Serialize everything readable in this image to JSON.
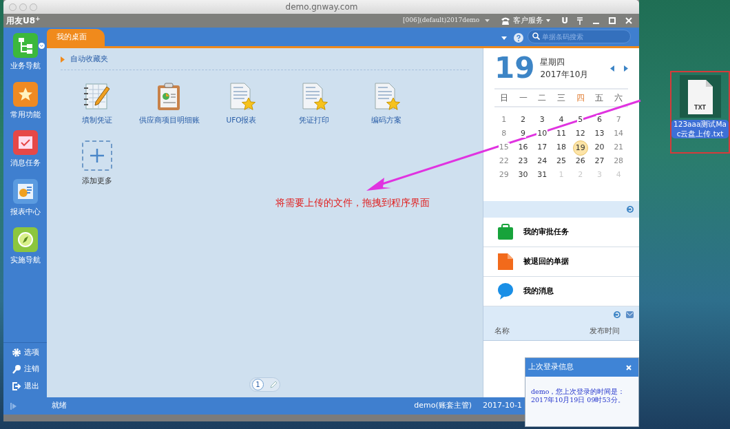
{
  "window": {
    "title": "demo.gnway.com"
  },
  "app_bar": {
    "logo": "用友U8$^{+}$",
    "account": "[006](default)2017demo",
    "service": "客户服务",
    "u_label": "U"
  },
  "sidebar": {
    "items": [
      {
        "label": "业务导航",
        "kind": "tree",
        "has_menu": true
      },
      {
        "label": "常用功能",
        "kind": "star",
        "has_menu": false
      },
      {
        "label": "消息任务",
        "kind": "check",
        "has_menu": false
      },
      {
        "label": "报表中心",
        "kind": "chart",
        "has_menu": false
      },
      {
        "label": "实施导航",
        "kind": "compass",
        "has_menu": false
      }
    ],
    "bottom_items": [
      {
        "label": "选项",
        "kind": "gear"
      },
      {
        "label": "注销",
        "kind": "key"
      },
      {
        "label": "退出",
        "kind": "exit"
      }
    ]
  },
  "tabs": [
    {
      "label": "我的桌面",
      "selected": true
    }
  ],
  "search": {
    "placeholder": "单据条码搜索"
  },
  "favorites": {
    "title": "自动收藏夹",
    "items": [
      {
        "label": "填制凭证",
        "kind": "ledger"
      },
      {
        "label": "供应商项目明细账",
        "kind": "clipboard"
      },
      {
        "label": "UFO报表",
        "kind": "report"
      },
      {
        "label": "凭证打印",
        "kind": "report"
      },
      {
        "label": "编码方案",
        "kind": "report"
      }
    ],
    "add_label": "添加更多"
  },
  "annotation": {
    "text": "将需要上传的文件，拖拽到程序界面"
  },
  "pager": {
    "pages": [
      {
        "label": "1",
        "selected": true
      }
    ]
  },
  "calendar": {
    "day": "19",
    "weekday": "星期四",
    "month": "2017年10月",
    "weekdays": [
      {
        "label": "日",
        "highlighted": false
      },
      {
        "label": "一",
        "highlighted": false
      },
      {
        "label": "二",
        "highlighted": false
      },
      {
        "label": "三",
        "highlighted": false
      },
      {
        "label": "四",
        "highlighted": true
      },
      {
        "label": "五",
        "highlighted": false
      },
      {
        "label": "六",
        "highlighted": false
      }
    ],
    "days": [
      {
        "label": "1",
        "kind": "current",
        "selected": false
      },
      {
        "label": "2",
        "kind": "current",
        "selected": false
      },
      {
        "label": "3",
        "kind": "current",
        "selected": false
      },
      {
        "label": "4",
        "kind": "current",
        "selected": false
      },
      {
        "label": "5",
        "kind": "current",
        "selected": false
      },
      {
        "label": "6",
        "kind": "current",
        "selected": false
      },
      {
        "label": "7",
        "kind": "current",
        "selected": false
      },
      {
        "label": "8",
        "kind": "current",
        "selected": false
      },
      {
        "label": "9",
        "kind": "current",
        "selected": false
      },
      {
        "label": "10",
        "kind": "current",
        "selected": false
      },
      {
        "label": "11",
        "kind": "current",
        "selected": false
      },
      {
        "label": "12",
        "kind": "current",
        "selected": false
      },
      {
        "label": "13",
        "kind": "current",
        "selected": false
      },
      {
        "label": "14",
        "kind": "current",
        "selected": false
      },
      {
        "label": "15",
        "kind": "current",
        "selected": false
      },
      {
        "label": "16",
        "kind": "current",
        "selected": false
      },
      {
        "label": "17",
        "kind": "current",
        "selected": false
      },
      {
        "label": "18",
        "kind": "current",
        "selected": false
      },
      {
        "label": "19",
        "kind": "current",
        "selected": true
      },
      {
        "label": "20",
        "kind": "current",
        "selected": false
      },
      {
        "label": "21",
        "kind": "current",
        "selected": false
      },
      {
        "label": "22",
        "kind": "current",
        "selected": false
      },
      {
        "label": "23",
        "kind": "current",
        "selected": false
      },
      {
        "label": "24",
        "kind": "current",
        "selected": false
      },
      {
        "label": "25",
        "kind": "current",
        "selected": false
      },
      {
        "label": "26",
        "kind": "current",
        "selected": false
      },
      {
        "label": "27",
        "kind": "current",
        "selected": false
      },
      {
        "label": "28",
        "kind": "current",
        "selected": false
      },
      {
        "label": "29",
        "kind": "current",
        "selected": false
      },
      {
        "label": "30",
        "kind": "current",
        "selected": false
      },
      {
        "label": "31",
        "kind": "current",
        "selected": false
      },
      {
        "label": "1",
        "kind": "other",
        "selected": false
      },
      {
        "label": "2",
        "kind": "other",
        "selected": false
      },
      {
        "label": "3",
        "kind": "other",
        "selected": false
      },
      {
        "label": "4",
        "kind": "other",
        "selected": false
      }
    ]
  },
  "tasks": [
    {
      "label": "我的审批任务",
      "kind": "briefcase"
    },
    {
      "label": "被退回的单据",
      "kind": "document"
    },
    {
      "label": "我的消息",
      "kind": "bubble"
    }
  ],
  "notices": {
    "columns": [
      "名称",
      "发布时间"
    ]
  },
  "status_bar": {
    "status": "就绪",
    "user": "demo(账套主管)",
    "date": "2017-10-1"
  },
  "popup": {
    "title": "上次登录信息",
    "lines": [
      "demo，您上次登录的时间是：",
      "2017年10月19日 09时53分。"
    ]
  },
  "desktop_file": {
    "badge": "TXT",
    "name": "123aaa测试Mac云盘上传.txt",
    "selected": true
  }
}
